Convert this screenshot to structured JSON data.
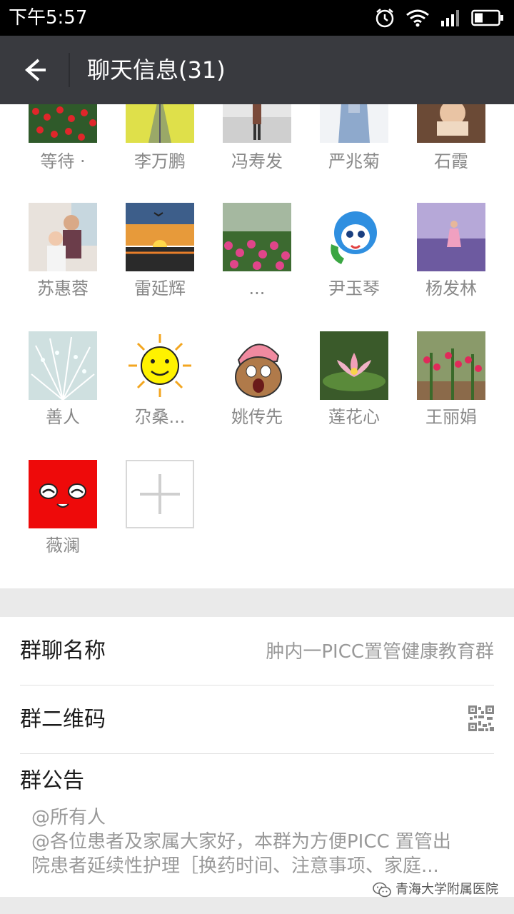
{
  "status_bar": {
    "time": "下午5:57",
    "icons": [
      "alarm-icon",
      "wifi-icon",
      "signal-icon",
      "battery-icon"
    ]
  },
  "nav": {
    "title": "聊天信息(31)",
    "back_icon": "back-arrow-icon"
  },
  "members": [
    {
      "name": "等待 ·"
    },
    {
      "name": "李万鹏"
    },
    {
      "name": "冯寿发"
    },
    {
      "name": "严兆菊"
    },
    {
      "name": "石霞"
    },
    {
      "name": "苏惠蓉"
    },
    {
      "name": "雷延辉"
    },
    {
      "name": "..."
    },
    {
      "name": "尹玉琴"
    },
    {
      "name": "杨发林"
    },
    {
      "name": "善人"
    },
    {
      "name": "尕桑..."
    },
    {
      "name": "姚传先"
    },
    {
      "name": "莲花心"
    },
    {
      "name": "王丽娟"
    },
    {
      "name": "薇澜"
    }
  ],
  "add_member_icon": "plus-icon",
  "settings": {
    "group_name_label": "群聊名称",
    "group_name_value": "肿内一PICC置管健康教育群",
    "qrcode_label": "群二维码",
    "qrcode_icon": "qr-code-icon",
    "announcement_label": "群公告",
    "announcement_lines": [
      "@所有人",
      "@各位患者及家属大家好，本群为方便PICC 置管出",
      "院患者延续性护理［换药时间、注意事项、家庭..."
    ]
  },
  "watermark": "青海大学附属医院",
  "colors": {
    "nav_bg": "#393a3f",
    "status_bg": "#000000",
    "section_gap": "#eaeaea",
    "muted_text": "#999999"
  }
}
